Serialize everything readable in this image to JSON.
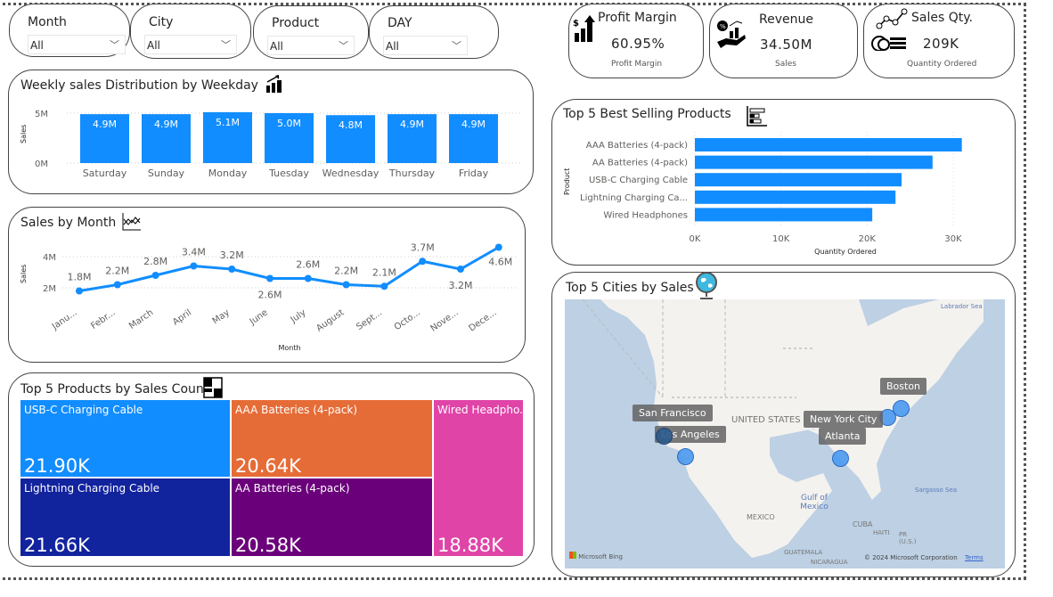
{
  "slicers": [
    {
      "label": "Month",
      "value": "All"
    },
    {
      "label": "City",
      "value": "All"
    },
    {
      "label": "Product",
      "value": "All"
    },
    {
      "label": "DAY",
      "value": "All"
    }
  ],
  "kpis": [
    {
      "title": "Profit Margin",
      "value": "60.95%",
      "subtitle": "Profit Margin",
      "icon": "profit-chart-icon"
    },
    {
      "title": "Revenue",
      "value": "34.50M",
      "subtitle": "Sales",
      "icon": "hand-money-icon"
    },
    {
      "title": "Sales Qty.",
      "value": "209K",
      "subtitle": "Quantity Ordered",
      "icon": "coins-chart-icon"
    }
  ],
  "colors": {
    "accent": "#118DFF",
    "treemap": [
      "#118DFF",
      "#E66C37",
      "#E044A7",
      "#12239E",
      "#6B007B"
    ]
  },
  "chart_data": [
    {
      "type": "bar",
      "title": "Weekly sales Distribution by Weekday",
      "ylabel": "Sales",
      "xlabel": "",
      "categories": [
        "Saturday",
        "Sunday",
        "Monday",
        "Tuesday",
        "Wednesday",
        "Thursday",
        "Friday"
      ],
      "values": [
        4.9,
        4.9,
        5.1,
        5.0,
        4.8,
        4.9,
        4.9
      ],
      "data_labels": [
        "4.9M",
        "4.9M",
        "5.1M",
        "5.0M",
        "4.8M",
        "4.9M",
        "4.9M"
      ],
      "yticks": [
        "0M",
        "5M"
      ],
      "ylim": [
        0,
        5
      ],
      "unit": "M",
      "grid": true
    },
    {
      "type": "line",
      "title": "Sales by Month",
      "ylabel": "Sales",
      "xlabel": "Month",
      "categories": [
        "Janu...",
        "Febr...",
        "March",
        "April",
        "May",
        "June",
        "July",
        "August",
        "Sept...",
        "Octo...",
        "Nove...",
        "Dece..."
      ],
      "values": [
        1.8,
        2.2,
        2.8,
        3.4,
        3.2,
        2.6,
        2.6,
        2.2,
        2.1,
        3.7,
        3.2,
        4.6
      ],
      "data_labels": [
        "1.8M",
        "2.2M",
        "2.8M",
        "3.4M",
        "3.2M",
        "2.6M",
        "2.6M",
        "2.2M",
        "2.1M",
        "3.7M",
        "3.2M",
        "4.6M"
      ],
      "yticks": [
        "2M",
        "4M"
      ],
      "unit": "M",
      "grid": true
    },
    {
      "type": "treemap",
      "title": "Top 5 Products by Sales Count",
      "categories": [
        "USB-C Charging Cable",
        "AAA Batteries (4-pack)",
        "Wired Headpho...",
        "Lightning Charging Cable",
        "AA Batteries (4-pack)"
      ],
      "values": [
        21.9,
        20.64,
        18.88,
        21.66,
        20.58
      ],
      "data_labels": [
        "21.90K",
        "20.64K",
        "18.88K",
        "21.66K",
        "20.58K"
      ]
    },
    {
      "type": "bar",
      "orientation": "horizontal",
      "title": "Top 5 Best Selling Products",
      "ylabel": "Product",
      "xlabel": "Quantity Ordered",
      "categories": [
        "AAA Batteries (4-pack)",
        "AA Batteries (4-pack)",
        "USB-C Charging Cable",
        "Lightning Charging Ca...",
        "Wired Headphones"
      ],
      "values": [
        31000,
        27600,
        24000,
        23300,
        20600
      ],
      "xticks": [
        "0K",
        "10K",
        "20K",
        "30K"
      ],
      "xlim": [
        0,
        30000
      ],
      "grid": true
    }
  ],
  "map": {
    "title": "Top 5 Cities by Sales",
    "cities": [
      "San Francisco",
      "Los Angeles",
      "New York City",
      "Atlanta",
      "Boston"
    ],
    "labels": {
      "country": "UNITED STATES",
      "gulf": "Gulf of Mexico",
      "mexico": "MEXICO",
      "cuba": "CUBA",
      "haiti": "HAITI",
      "pr": "PR (U.S.)",
      "guatemala": "GUATEMALA",
      "nicaragua": "NICARAGUA",
      "labrador": "Labrador Sea",
      "sargasso": "Sargasso Sea"
    },
    "bing": "Microsoft Bing",
    "copyright": "© 2024 Microsoft Corporation",
    "terms": "Terms"
  }
}
